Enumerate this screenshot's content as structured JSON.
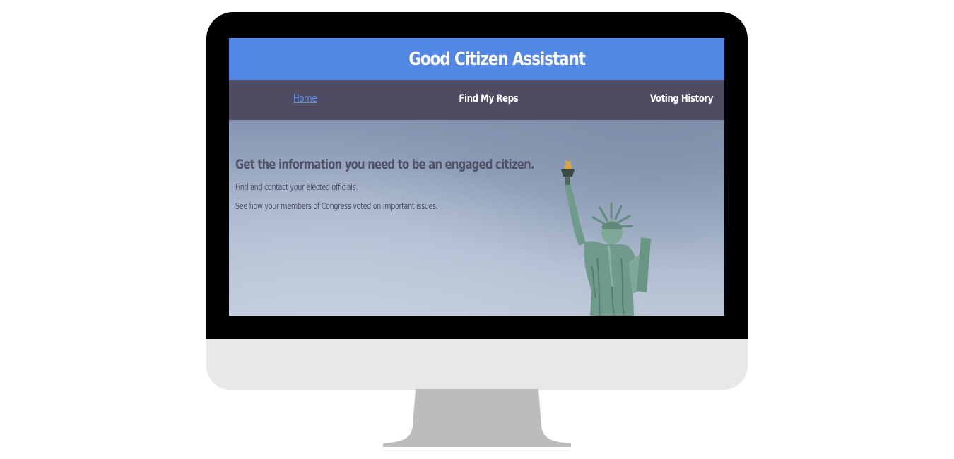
{
  "site": {
    "title": "Good Citizen Assistant"
  },
  "nav": {
    "items": [
      {
        "label": "Home",
        "active": true
      },
      {
        "label": "Find My Reps",
        "active": false
      },
      {
        "label": "Voting History",
        "active": false
      }
    ]
  },
  "hero": {
    "heading": "Get the information you need to be an engaged citizen.",
    "lines": [
      "Find and contact your elected officials.",
      "See how your members of Congress voted on important issues."
    ],
    "image": "statue-of-liberty"
  },
  "colors": {
    "header_bg": "#5488e6",
    "nav_bg": "#4f4b63",
    "active_link": "#5b8fe8",
    "hero_text": "#4f5266",
    "statue": "#6f9a8c"
  }
}
